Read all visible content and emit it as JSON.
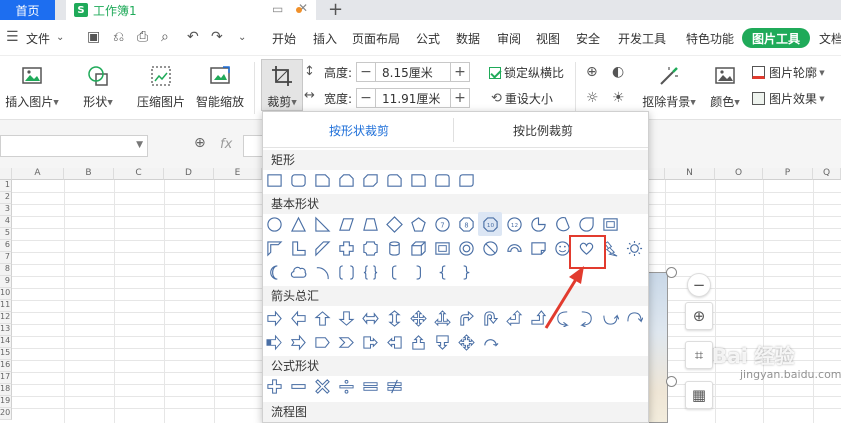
{
  "tabbar": {
    "home_tab": "首页",
    "workbook_tab": "工作簿1",
    "workbook_logo": "S",
    "new_tab_icon": "plus-icon"
  },
  "menubar": {
    "file_label": "文件",
    "items": [
      "开始",
      "插入",
      "页面布局",
      "公式",
      "数据",
      "审阅",
      "视图",
      "安全",
      "开发工具",
      "特色功能"
    ],
    "active_tab": "图片工具",
    "overflow_item": "文档"
  },
  "ribbon": {
    "insert_image": "插入图片",
    "shape": "形状",
    "compress": "压缩图片",
    "smart_scale": "智能缩放",
    "crop": "裁剪",
    "height_label": "高度:",
    "height_value": "8.15厘米",
    "width_label": "宽度:",
    "width_value": "11.91厘米",
    "lock_ratio": "锁定纵横比",
    "reset_size": "重设大小",
    "cutout_bg": "抠除背景",
    "color": "颜色",
    "outline": "图片轮廓",
    "effects": "图片效果"
  },
  "formulabar": {
    "fx_label": "fx"
  },
  "grid": {
    "columns": [
      "A",
      "B",
      "C",
      "D",
      "E",
      "N",
      "O",
      "P",
      "Q"
    ],
    "rows": [
      "1",
      "2",
      "3",
      "4",
      "5",
      "6",
      "7",
      "8",
      "9",
      "10",
      "11",
      "12",
      "13",
      "14",
      "15",
      "16",
      "17",
      "18",
      "19",
      "20"
    ]
  },
  "dropdown": {
    "tab_by_shape": "按形状裁剪",
    "tab_by_ratio": "按比例裁剪",
    "sections": {
      "rectangle": "矩形",
      "basic_shapes": "基本形状",
      "arrows": "箭头总汇",
      "formula_shapes": "公式形状",
      "flowchart": "流程图"
    },
    "hex_badge_1": "10",
    "hex_badge_2": "12"
  },
  "colors": {
    "accent_green": "#1faa59",
    "tab_blue": "#1d6ef0",
    "link_blue": "#1e6fd9",
    "highlight_red": "#e23b2e"
  },
  "watermark": {
    "main": "Bai 经验",
    "sub": "jingyan.baidu.com"
  }
}
